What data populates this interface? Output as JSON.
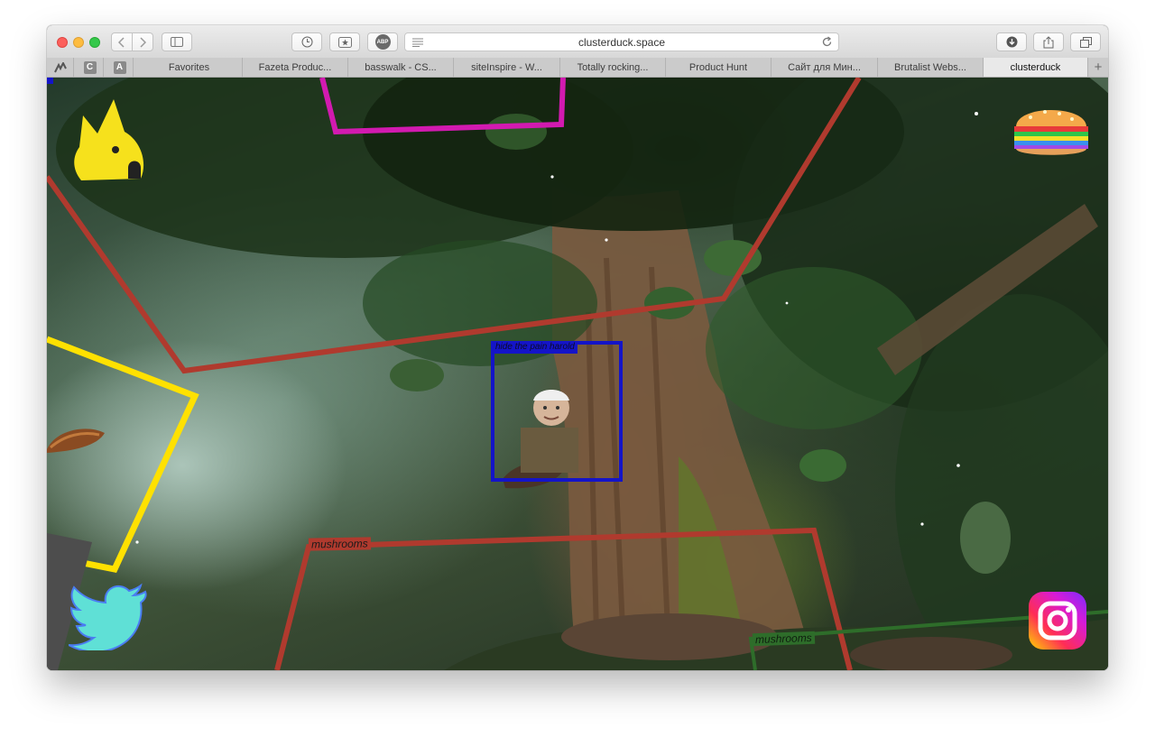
{
  "browser": {
    "url": "clusterduck.space",
    "adblock_label": "ABP",
    "pinned": [
      "C",
      "A"
    ],
    "tabs": [
      {
        "label": "Favorites",
        "active": false
      },
      {
        "label": "Fazeta Produc...",
        "active": false
      },
      {
        "label": "basswalk - CS...",
        "active": false
      },
      {
        "label": "siteInspire - W...",
        "active": false
      },
      {
        "label": "Totally rocking...",
        "active": false
      },
      {
        "label": "Product Hunt",
        "active": false
      },
      {
        "label": "Сайт для Мин...",
        "active": false
      },
      {
        "label": "Brutalist Webs...",
        "active": false
      },
      {
        "label": "clusterduck",
        "active": true
      }
    ],
    "new_tab_label": "+"
  },
  "page": {
    "frame_labels": {
      "mushrooms_left": "mushrooms",
      "mushrooms_right": "mushrooms",
      "blue_box": "hide the pain harold"
    },
    "icons": {
      "logo": "yellow-dog-logo-icon",
      "top_right": "rainbow-burger-icon",
      "bottom_left": "twitter-bird-icon",
      "bottom_right": "instagram-icon"
    },
    "colors": {
      "red_line": "#b03a2e",
      "yellow_line": "#ffe100",
      "magenta_line": "#d21ab0",
      "blue_box": "#1414c8",
      "green_line": "#2e6d2a"
    }
  }
}
